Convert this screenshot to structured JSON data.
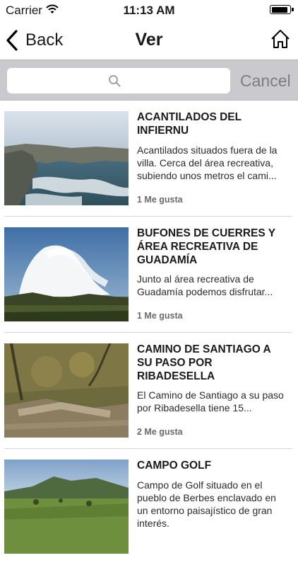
{
  "status_bar": {
    "carrier": "Carrier",
    "time": "11:13 AM",
    "battery_level": 0.92
  },
  "nav": {
    "back_label": "Back",
    "title": "Ver"
  },
  "search": {
    "placeholder": "",
    "cancel_label": "Cancel"
  },
  "items": [
    {
      "title": "ACANTILADOS DEL INFIERNU",
      "description": "Acantilados situados fuera de la villa. Cerca del área recreativa, subiendo unos metros el cami...",
      "likes": "1 Me gusta"
    },
    {
      "title": "BUFONES DE CUERRES Y ÁREA RECREATIVA DE GUADAMÍA",
      "description": "Junto al área recreativa de Guadamía podemos disfrutar...",
      "likes": "1 Me gusta"
    },
    {
      "title": "CAMINO DE SANTIAGO A SU PASO POR RIBADESELLA",
      "description": "El Camino de Santiago a su paso por Ribadesella tiene 15...",
      "likes": "2 Me gusta"
    },
    {
      "title": "CAMPO GOLF",
      "description": "Campo de Golf situado en el pueblo de Berbes enclavado en un entorno paisajístico de gran interés.",
      "likes": ""
    }
  ]
}
